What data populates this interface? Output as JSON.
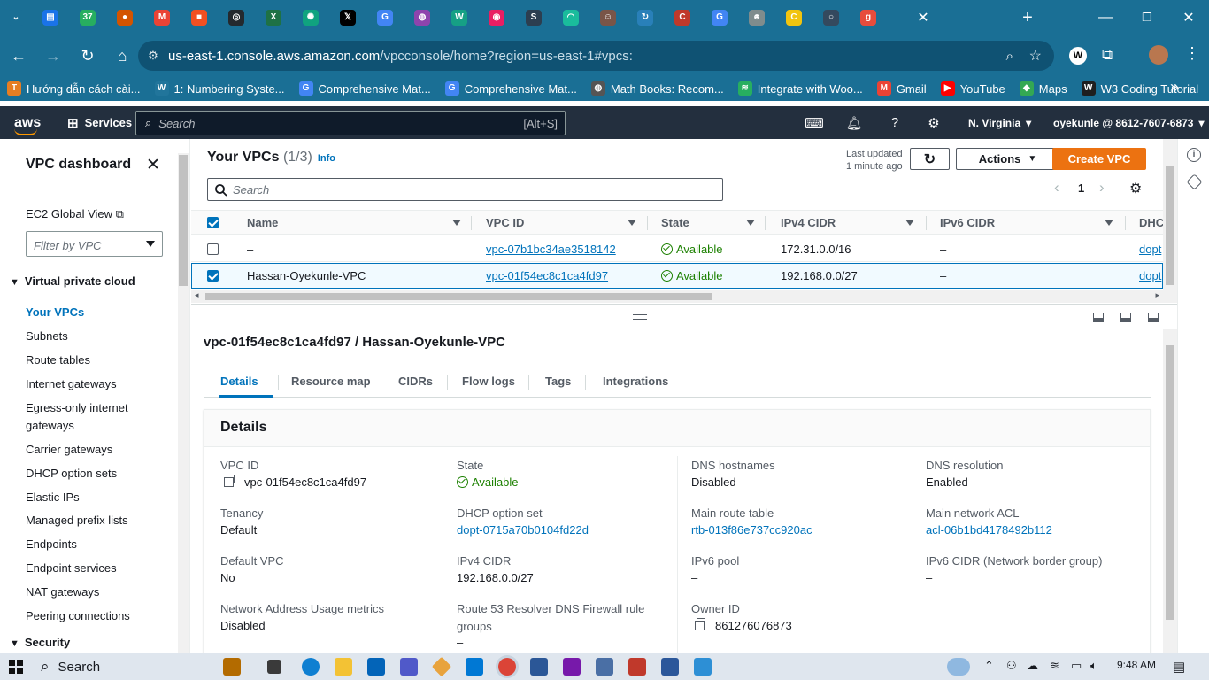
{
  "browser": {
    "tabs": [
      {
        "icon": "tab-list-icon",
        "color": "#1a6f95",
        "glyph": "⌄"
      },
      {
        "icon": "google-docs-icon",
        "color": "#1a73e8",
        "glyph": "▤"
      },
      {
        "icon": "badge-37-icon",
        "color": "#27ae60",
        "glyph": "37"
      },
      {
        "icon": "circle-icon",
        "color": "#d35400",
        "glyph": "●"
      },
      {
        "icon": "gmail-icon",
        "color": "#ea4335",
        "glyph": "M"
      },
      {
        "icon": "microsoft-icon",
        "color": "#f25022",
        "glyph": "■"
      },
      {
        "icon": "github-icon",
        "color": "#24292e",
        "glyph": "◎"
      },
      {
        "icon": "excel-icon",
        "color": "#1e7145",
        "glyph": "X"
      },
      {
        "icon": "chatgpt-icon",
        "color": "#10a37f",
        "glyph": "✺"
      },
      {
        "icon": "x-icon",
        "color": "#000000",
        "glyph": "𝕏"
      },
      {
        "icon": "google-icon",
        "color": "#4285f4",
        "glyph": "G"
      },
      {
        "icon": "globe-icon",
        "color": "#8e44ad",
        "glyph": "◍"
      },
      {
        "icon": "w-icon",
        "color": "#16a085",
        "glyph": "W"
      },
      {
        "icon": "screen-icon",
        "color": "#e91e63",
        "glyph": "◉"
      },
      {
        "icon": "s-icon",
        "color": "#2c3e50",
        "glyph": "S"
      },
      {
        "icon": "eye-icon",
        "color": "#1abc9c",
        "glyph": "◠"
      },
      {
        "icon": "avatar-tab-icon",
        "color": "#795548",
        "glyph": "☺"
      },
      {
        "icon": "refresh-blue-icon",
        "color": "#2980b9",
        "glyph": "↻"
      },
      {
        "icon": "c-red-icon",
        "color": "#c0392b",
        "glyph": "C"
      },
      {
        "icon": "google-icon",
        "color": "#4285f4",
        "glyph": "G"
      },
      {
        "icon": "person-icon",
        "color": "#7f8c8d",
        "glyph": "☻"
      },
      {
        "icon": "c-yellow-icon",
        "color": "#f1c40f",
        "glyph": "C"
      },
      {
        "icon": "ring-icon",
        "color": "#34495e",
        "glyph": "○"
      },
      {
        "icon": "g-red-icon",
        "color": "#e74c3c",
        "glyph": "g"
      }
    ],
    "close_label": "✕",
    "newtab_label": "+",
    "url_host": "us-east-1.console.aws.amazon.com",
    "url_path": "/vpcconsole/home?region=us-east-1#vpcs:",
    "bookmarks": [
      {
        "label": "Hướng dẫn cách cài...",
        "icon": "bookmark-icon",
        "color": "#e67e22",
        "glyph": "T"
      },
      {
        "label": "1: Numbering Syste...",
        "icon": "wordpress-icon",
        "color": "#21759b",
        "glyph": "W"
      },
      {
        "label": "Comprehensive Mat...",
        "icon": "google-icon",
        "color": "#4285f4",
        "glyph": "G"
      },
      {
        "label": "Comprehensive Mat...",
        "icon": "google-icon",
        "color": "#4285f4",
        "glyph": "G"
      },
      {
        "label": "Math Books: Recom...",
        "icon": "globe-icon",
        "color": "#555555",
        "glyph": "◍"
      },
      {
        "label": "Integrate with Woo...",
        "icon": "wifi-icon",
        "color": "#27ae60",
        "glyph": "≋"
      },
      {
        "label": "Gmail",
        "icon": "gmail-icon",
        "color": "#ea4335",
        "glyph": "M"
      },
      {
        "label": "YouTube",
        "icon": "youtube-icon",
        "color": "#ff0000",
        "glyph": "▶"
      },
      {
        "label": "Maps",
        "icon": "maps-icon",
        "color": "#34a853",
        "glyph": "◆"
      },
      {
        "label": "W3 Coding Tutorial",
        "icon": "w3-icon",
        "color": "#1e1e1e",
        "glyph": "W"
      }
    ]
  },
  "aws": {
    "logo": "aws",
    "services": "Services",
    "search_placeholder": "Search",
    "search_shortcut": "[Alt+S]",
    "region": "N. Virginia",
    "account": "oyekunle @ 8612-7607-6873"
  },
  "sidebar": {
    "title": "VPC dashboard",
    "ec2_global": "EC2 Global View",
    "filter_placeholder": "Filter by VPC",
    "section": "Virtual private cloud",
    "items": [
      "Your VPCs",
      "Subnets",
      "Route tables",
      "Internet gateways",
      "Egress-only internet",
      "gateways",
      "Carrier gateways",
      "DHCP option sets",
      "Elastic IPs",
      "Managed prefix lists",
      "Endpoints",
      "Endpoint services",
      "NAT gateways",
      "Peering connections"
    ],
    "section2": "Security"
  },
  "vpcs": {
    "title": "Your VPCs",
    "count": "(1/3)",
    "info": "Info",
    "last_updated_1": "Last updated",
    "last_updated_2": "1 minute ago",
    "actions": "Actions",
    "create": "Create VPC",
    "search_placeholder": "Search",
    "page": "1",
    "columns": [
      "Name",
      "VPC ID",
      "State",
      "IPv4 CIDR",
      "IPv6 CIDR",
      "DHC"
    ],
    "rows": [
      {
        "name": "–",
        "vpc_id": "vpc-07b1bc34ae3518142",
        "state": "Available",
        "ipv4": "172.31.0.0/16",
        "ipv6": "–",
        "dhcp": "dopt",
        "selected": false
      },
      {
        "name": "Hassan-Oyekunle-VPC",
        "vpc_id": "vpc-01f54ec8c1ca4fd97",
        "state": "Available",
        "ipv4": "192.168.0.0/27",
        "ipv6": "–",
        "dhcp": "dopt",
        "selected": true
      }
    ]
  },
  "detail": {
    "title": "vpc-01f54ec8c1ca4fd97 / Hassan-Oyekunle-VPC",
    "tabs": [
      "Details",
      "Resource map",
      "CIDRs",
      "Flow logs",
      "Tags",
      "Integrations"
    ],
    "panel_title": "Details",
    "fields": {
      "vpc_id_k": "VPC ID",
      "vpc_id_v": "vpc-01f54ec8c1ca4fd97",
      "state_k": "State",
      "state_v": "Available",
      "dns_host_k": "DNS hostnames",
      "dns_host_v": "Disabled",
      "dns_res_k": "DNS resolution",
      "dns_res_v": "Enabled",
      "tenancy_k": "Tenancy",
      "tenancy_v": "Default",
      "dhcp_k": "DHCP option set",
      "dhcp_v": "dopt-0715a70b0104fd22d",
      "rt_k": "Main route table",
      "rt_v": "rtb-013f86e737cc920ac",
      "acl_k": "Main network ACL",
      "acl_v": "acl-06b1bd4178492b112",
      "defvpc_k": "Default VPC",
      "defvpc_v": "No",
      "ipv4_k": "IPv4 CIDR",
      "ipv4_v": "192.168.0.0/27",
      "ipv6pool_k": "IPv6 pool",
      "ipv6pool_v": "–",
      "ipv6cidr_k": "IPv6 CIDR (Network border group)",
      "ipv6cidr_v": "–",
      "nau_k": "Network Address Usage metrics",
      "nau_v": "Disabled",
      "r53_k1": "Route 53 Resolver DNS Firewall rule",
      "r53_k2": "groups",
      "r53_v": "–",
      "owner_k": "Owner ID",
      "owner_v": "861276076873"
    }
  },
  "taskbar": {
    "search": "Search",
    "time": "9:48 AM"
  },
  "colors": {
    "accent": "#0073bb",
    "primary_button": "#ec7211",
    "aws_nav": "#232f3e",
    "browser": "#1a6f95",
    "success": "#1d8102"
  }
}
